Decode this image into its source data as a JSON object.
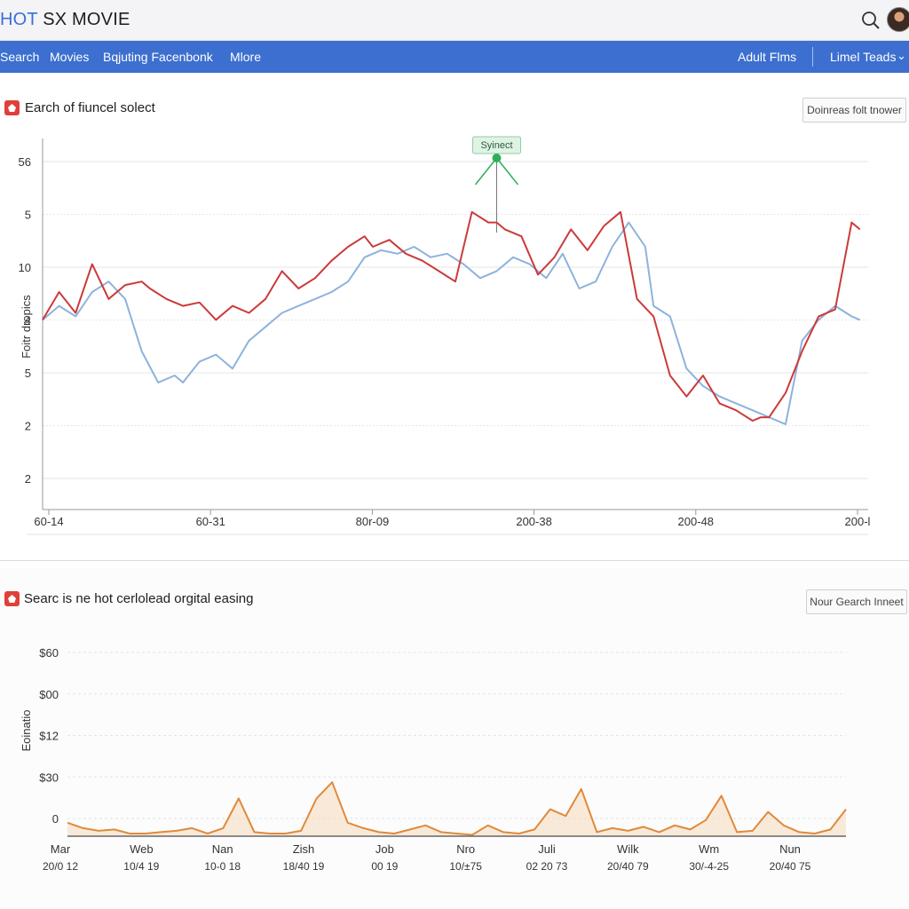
{
  "app": {
    "title_part1": "HOT",
    "title_part2": " SX MOVIE"
  },
  "icons": {
    "search": "search-icon",
    "avatar": "avatar",
    "panel": "alert-icon",
    "chevron": "chevron-down-icon"
  },
  "nav": {
    "items": [
      "Search",
      "Movies",
      "Bqjuting Facenbonk",
      "Mlore"
    ],
    "right_items": [
      "Adult Flms",
      "Limel Teads"
    ]
  },
  "colors": {
    "nav": "#3c6fcf",
    "red_series": "#cc3a3a",
    "blue_series": "#8db3dc",
    "orange_series": "#e08a3c",
    "annotation": "#2fae5a"
  },
  "panel1": {
    "title": "Earch of fiuncel solect",
    "button": "Doinreas folt tnower"
  },
  "panel2": {
    "title": "Searc is ne hot cerlolead orgital easing",
    "button": "Nour Gearch Inneet"
  },
  "chart_data": [
    {
      "type": "line",
      "title": "Earch of fiuncel solect",
      "ylabel": "Foitr dropics",
      "ytick_labels": [
        "56",
        "5",
        "10",
        "4",
        "5",
        "2",
        "2"
      ],
      "xtick_labels": [
        "60-14",
        "60-31",
        "80r-09",
        "200-38",
        "200-48",
        "200-l"
      ],
      "annotation": {
        "label": "Syinect",
        "x": 55
      },
      "xlim": [
        0,
        100
      ],
      "ylim": [
        0,
        100
      ],
      "grid": true,
      "series": [
        {
          "color": "#cc3a3a",
          "x": [
            0,
            2,
            4,
            6,
            8,
            10,
            12,
            13,
            15,
            17,
            19,
            21,
            23,
            25,
            27,
            29,
            31,
            33,
            35,
            37,
            39,
            40,
            42,
            44,
            46,
            48,
            50,
            52,
            54,
            55,
            56,
            58,
            60,
            62,
            64,
            66,
            68,
            70,
            72,
            74,
            76,
            78,
            80,
            82,
            84,
            86,
            87,
            88,
            90,
            92,
            94,
            96,
            98,
            99
          ],
          "y": [
            54,
            62,
            56,
            70,
            60,
            64,
            65,
            63,
            60,
            58,
            59,
            54,
            58,
            56,
            60,
            68,
            63,
            66,
            71,
            75,
            78,
            75,
            77,
            73,
            71,
            68,
            65,
            85,
            82,
            82,
            80,
            78,
            67,
            72,
            80,
            74,
            81,
            85,
            60,
            55,
            38,
            32,
            38,
            30,
            28,
            25,
            26,
            26,
            33,
            45,
            55,
            57,
            82,
            80
          ]
        },
        {
          "color": "#8db3dc",
          "x": [
            0,
            2,
            4,
            6,
            8,
            10,
            12,
            14,
            16,
            17,
            19,
            21,
            23,
            25,
            27,
            29,
            31,
            33,
            35,
            37,
            39,
            41,
            43,
            45,
            47,
            49,
            51,
            53,
            55,
            57,
            59,
            61,
            63,
            65,
            67,
            69,
            71,
            73,
            74,
            76,
            78,
            80,
            82,
            84,
            86,
            88,
            90,
            92,
            94,
            96,
            98,
            99
          ],
          "y": [
            54,
            58,
            55,
            62,
            65,
            60,
            45,
            36,
            38,
            36,
            42,
            44,
            40,
            48,
            52,
            56,
            58,
            60,
            62,
            65,
            72,
            74,
            73,
            75,
            72,
            73,
            70,
            66,
            68,
            72,
            70,
            66,
            73,
            63,
            65,
            75,
            82,
            75,
            58,
            55,
            40,
            35,
            32,
            30,
            28,
            26,
            24,
            48,
            54,
            58,
            55,
            54
          ]
        }
      ]
    },
    {
      "type": "area",
      "title": "Searc is ne hot cerlolead orgital easing",
      "ylabel": "Eoinatio",
      "ytick_labels": [
        "$60",
        "$00",
        "$12",
        "$30",
        "0"
      ],
      "xtick_labels": [
        "Mar",
        "Web",
        "Nan",
        "Zish",
        "Job",
        "Nro",
        "Juli",
        "Wilk",
        "Wm",
        "Nun"
      ],
      "xtick_sublabels": [
        "20/0 12",
        "10/4 19",
        "10-0 18",
        "18/40 19",
        "00 19",
        "10/±75",
        "02 20 73",
        "20/40 79",
        "30/-4-25",
        "20/40 75"
      ],
      "xlim": [
        0,
        100
      ],
      "ylim": [
        0,
        100
      ],
      "grid": true,
      "series": [
        {
          "color": "#e08a3c",
          "x": [
            0,
            2,
            4,
            6,
            8,
            10,
            12,
            14,
            16,
            18,
            20,
            22,
            24,
            26,
            28,
            30,
            32,
            34,
            36,
            38,
            40,
            42,
            44,
            46,
            48,
            50,
            52,
            54,
            56,
            58,
            60,
            62,
            64,
            66,
            68,
            70,
            72,
            74,
            76,
            78,
            80,
            82,
            84,
            86,
            88,
            90,
            92,
            94,
            96,
            98,
            100
          ],
          "y": [
            10,
            6,
            4,
            5,
            2,
            2,
            3,
            4,
            6,
            2,
            6,
            28,
            3,
            2,
            2,
            4,
            28,
            40,
            10,
            6,
            3,
            2,
            5,
            8,
            3,
            2,
            1,
            8,
            3,
            2,
            5,
            20,
            15,
            35,
            3,
            6,
            4,
            7,
            3,
            8,
            5,
            12,
            30,
            3,
            4,
            18,
            8,
            3,
            2,
            5,
            20
          ]
        }
      ]
    }
  ]
}
